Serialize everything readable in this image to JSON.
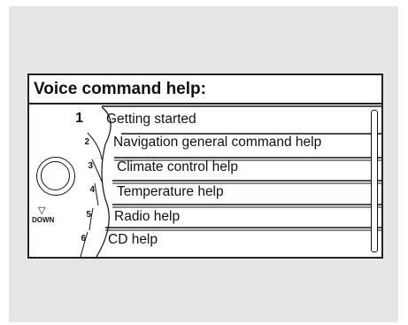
{
  "screen": {
    "title": "Voice command help:"
  },
  "list": {
    "items": [
      {
        "number": "1",
        "label": "Getting started",
        "selected": true
      },
      {
        "number": "2",
        "label": "Navigation general command help",
        "selected": false
      },
      {
        "number": "3",
        "label": "Climate control help",
        "selected": false
      },
      {
        "number": "4",
        "label": "Temperature help",
        "selected": false
      },
      {
        "number": "5",
        "label": "Radio help",
        "selected": false
      },
      {
        "number": "6",
        "label": "CD help",
        "selected": false
      }
    ]
  },
  "controls": {
    "down_label": "DOWN",
    "down_icon": "triangle-down-icon",
    "knob_icon": "selector-knob-icon"
  },
  "colors": {
    "background": "#e6e6e6",
    "screen": "#ffffff",
    "ink": "#111111"
  }
}
